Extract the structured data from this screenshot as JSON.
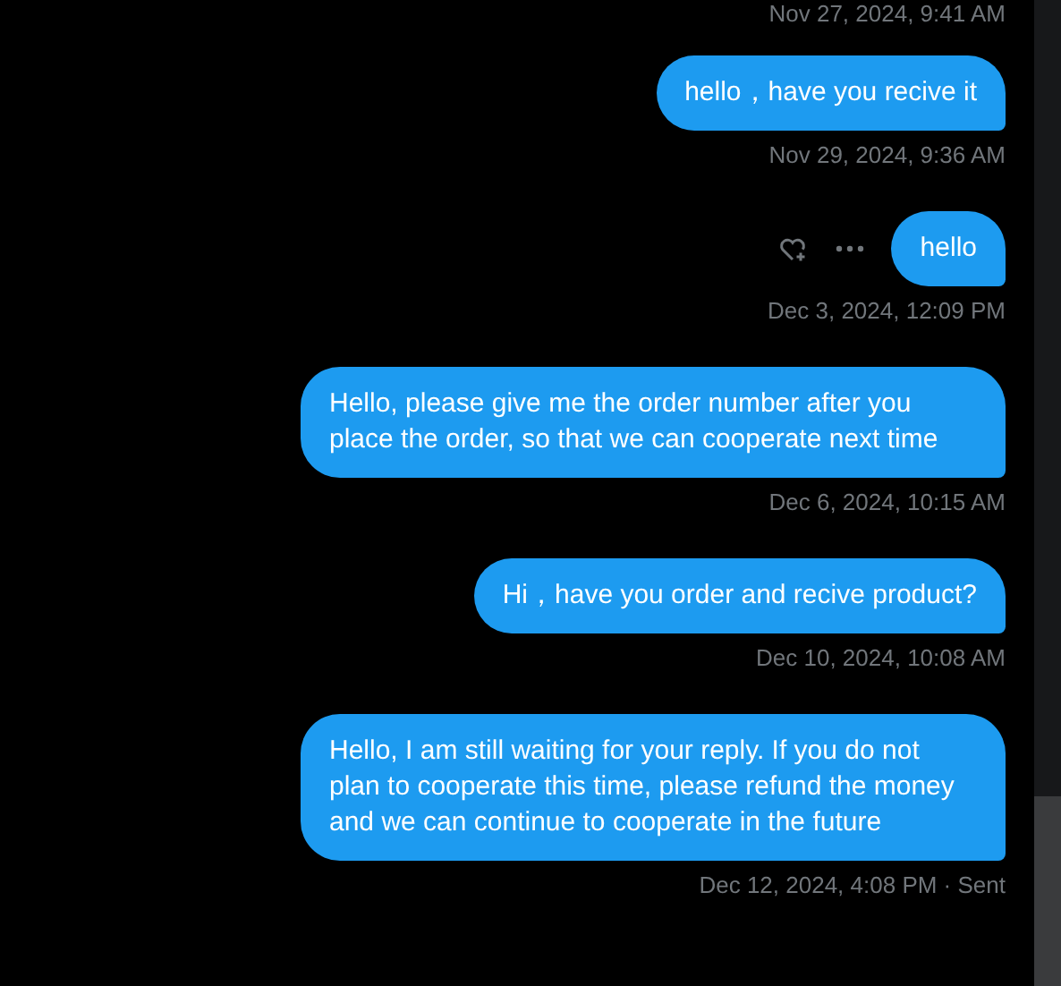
{
  "top_timestamp": "Nov 27, 2024, 9:41 AM",
  "messages": [
    {
      "text": "hello，have you recive it",
      "timestamp": "Nov 29, 2024, 9:36 AM",
      "hovered": false
    },
    {
      "text": "hello",
      "timestamp": "Dec 3, 2024, 12:09 PM",
      "hovered": true
    },
    {
      "text": "Hello, please give me the order number after you place the order, so that we can cooperate next time",
      "timestamp": "Dec 6, 2024, 10:15 AM",
      "hovered": false
    },
    {
      "text": "Hi，have you order and recive product?",
      "timestamp": "Dec 10, 2024, 10:08 AM",
      "hovered": false
    },
    {
      "text": "Hello, I am still waiting for your reply. If you do not plan to cooperate this time, please refund the money and we can continue to cooperate in the future",
      "timestamp": "Dec 12, 2024, 4:08 PM · Sent",
      "hovered": false
    }
  ]
}
